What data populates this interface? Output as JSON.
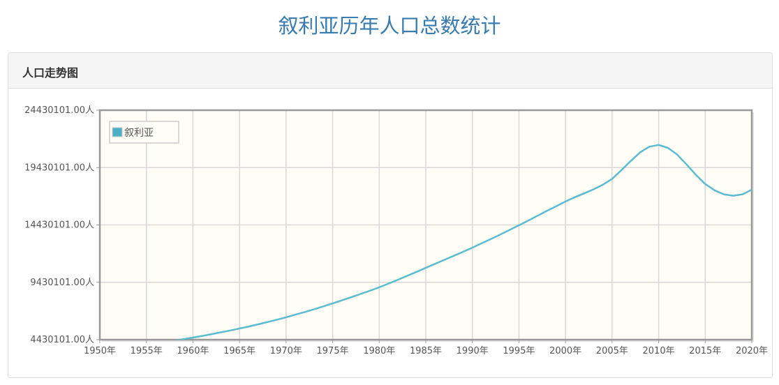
{
  "page_title": "叙利亚历年人口总数统计",
  "panel_title": "人口走势图",
  "colors": {
    "line": "#5bbccf",
    "plot_bg": "#fffdf6",
    "title": "#3a7bb0"
  },
  "chart_data": {
    "type": "line",
    "title": "人口走势图",
    "xlabel": "",
    "ylabel": "",
    "xlim": [
      1950,
      2020
    ],
    "ylim": [
      4430101,
      24430101
    ],
    "x_ticks": [
      "1950年",
      "1955年",
      "1960年",
      "1965年",
      "1970年",
      "1975年",
      "1980年",
      "1985年",
      "1990年",
      "1995年",
      "2000年",
      "2005年",
      "2010年",
      "2015年",
      "2020年"
    ],
    "y_ticks": [
      "4430101.00人",
      "9430101.00人",
      "14430101.00人",
      "19430101.00人",
      "24430101.00人"
    ],
    "legend": {
      "position": "top-left",
      "entries": [
        "叙利亚"
      ]
    },
    "grid": true,
    "series": [
      {
        "name": "叙利亚",
        "x": [
          1958,
          1959,
          1960,
          1961,
          1962,
          1963,
          1964,
          1965,
          1966,
          1967,
          1968,
          1969,
          1970,
          1971,
          1972,
          1973,
          1974,
          1975,
          1976,
          1977,
          1978,
          1979,
          1980,
          1981,
          1982,
          1983,
          1984,
          1985,
          1986,
          1987,
          1988,
          1989,
          1990,
          1991,
          1992,
          1993,
          1994,
          1995,
          1996,
          1997,
          1998,
          1999,
          2000,
          2001,
          2002,
          2003,
          2004,
          2005,
          2006,
          2007,
          2008,
          2009,
          2010,
          2011,
          2012,
          2013,
          2014,
          2015,
          2016,
          2017,
          2018,
          2019,
          2020
        ],
        "values": [
          4350000,
          4480000,
          4610000,
          4760000,
          4910000,
          5070000,
          5230000,
          5400000,
          5580000,
          5770000,
          5960000,
          6170000,
          6380000,
          6610000,
          6840000,
          7080000,
          7330000,
          7590000,
          7860000,
          8130000,
          8410000,
          8700000,
          8990000,
          9320000,
          9650000,
          9990000,
          10340000,
          10690000,
          11040000,
          11390000,
          11740000,
          12090000,
          12450000,
          12830000,
          13210000,
          13600000,
          14000000,
          14400000,
          14810000,
          15230000,
          15650000,
          16060000,
          16470000,
          16850000,
          17180000,
          17530000,
          17930000,
          18450000,
          19200000,
          20000000,
          20750000,
          21250000,
          21400000,
          21150000,
          20550000,
          19700000,
          18800000,
          18000000,
          17450000,
          17100000,
          16980000,
          17100000,
          17500000
        ]
      }
    ]
  }
}
